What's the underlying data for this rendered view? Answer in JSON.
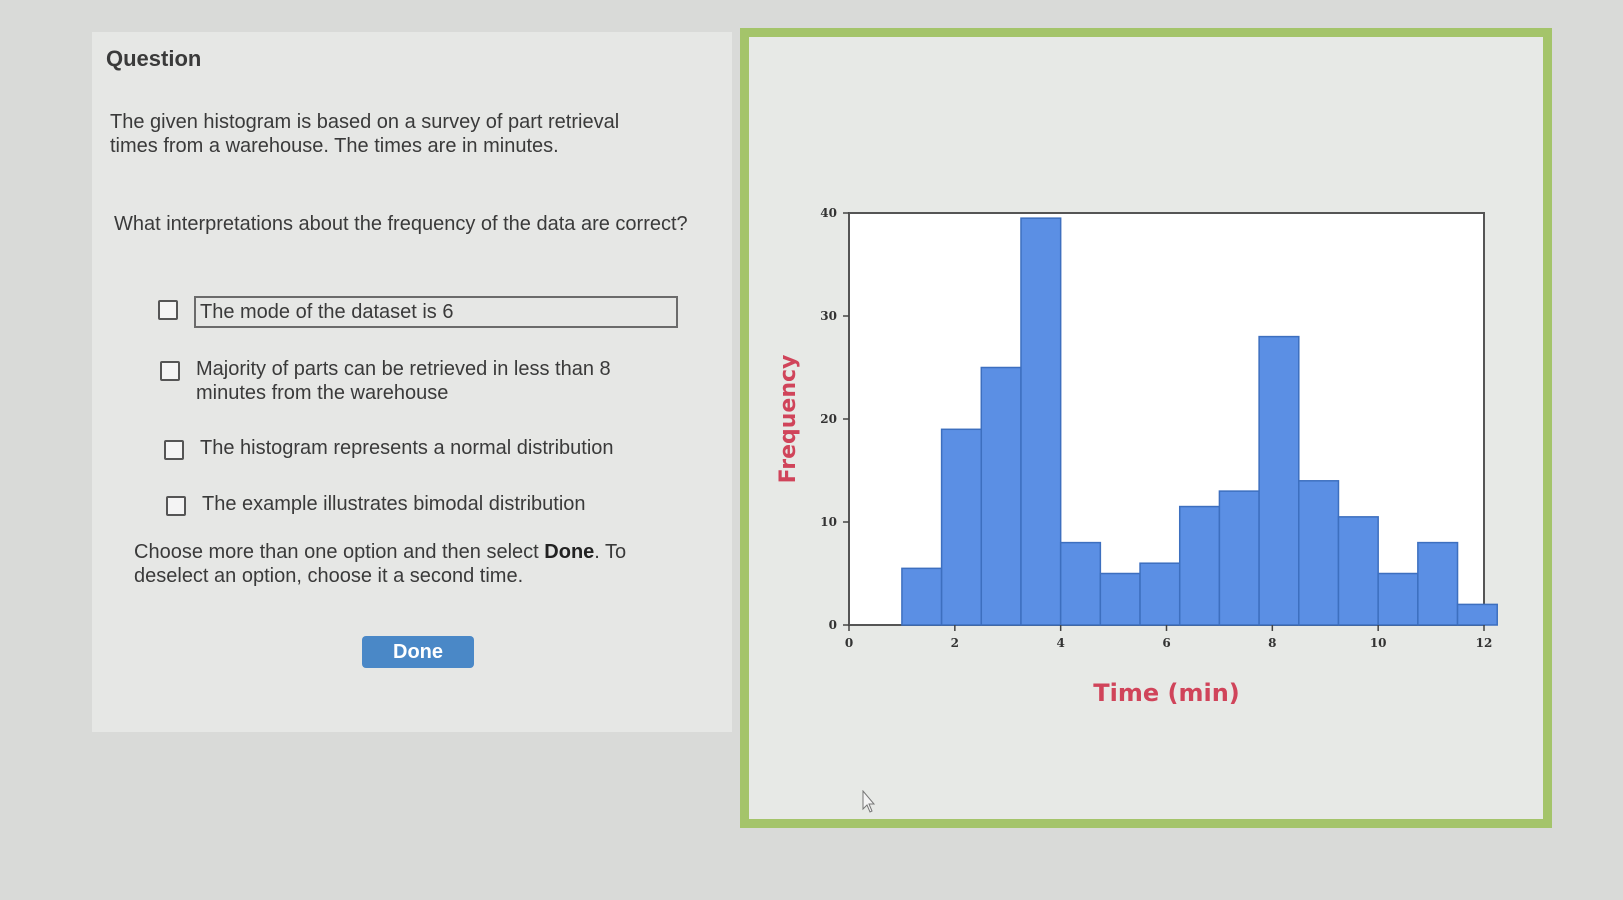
{
  "question": {
    "title": "Question",
    "intro": "The given histogram is based on a survey of part retrieval times from a warehouse. The times are in minutes.",
    "prompt": "What interpretations about the frequency of the data are correct?",
    "options": [
      {
        "label": "The mode of the dataset is 6",
        "checked": false
      },
      {
        "label": "Majority of parts can be retrieved in less than 8 minutes from the warehouse",
        "checked": false
      },
      {
        "label": "The histogram represents a normal distribution",
        "checked": false
      },
      {
        "label": "The example illustrates bimodal distribution",
        "checked": false
      }
    ],
    "instructions_pre": "Choose more than one option and then select ",
    "instructions_bold": "Done",
    "instructions_post": ". To deselect an option, choose it a second time.",
    "done_label": "Done"
  },
  "chart_data": {
    "type": "bar",
    "xlabel": "Time (min)",
    "ylabel": "Frequency",
    "xlim": [
      0,
      12
    ],
    "ylim": [
      0,
      40
    ],
    "xticks": [
      0,
      2,
      4,
      6,
      8,
      10,
      12
    ],
    "yticks": [
      0,
      10,
      20,
      30,
      40
    ],
    "bin_width": 0.75,
    "bins": [
      {
        "x": 1.0,
        "value": 5.5
      },
      {
        "x": 1.75,
        "value": 19
      },
      {
        "x": 2.5,
        "value": 25
      },
      {
        "x": 3.25,
        "value": 39.5
      },
      {
        "x": 4.0,
        "value": 8
      },
      {
        "x": 4.75,
        "value": 5
      },
      {
        "x": 5.5,
        "value": 6
      },
      {
        "x": 6.25,
        "value": 11.5
      },
      {
        "x": 7.0,
        "value": 13
      },
      {
        "x": 7.75,
        "value": 28
      },
      {
        "x": 8.5,
        "value": 14
      },
      {
        "x": 9.25,
        "value": 10.5
      },
      {
        "x": 10.0,
        "value": 5
      },
      {
        "x": 10.75,
        "value": 8
      },
      {
        "x": 11.5,
        "value": 2
      }
    ],
    "bar_color": "#5b8fe4",
    "label_color": "#d0445a"
  }
}
